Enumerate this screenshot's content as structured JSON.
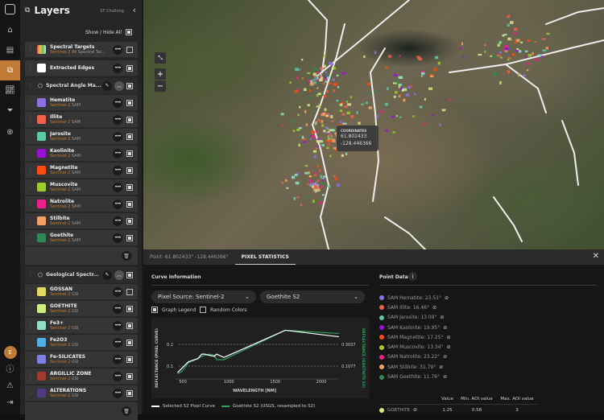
{
  "sidebar": {
    "title": "Layers",
    "user_label": "ST Challeng",
    "show_hide_all": "Show / Hide All",
    "top_layers": [
      {
        "name": "Spectral Targets",
        "source": "Sentinel-2",
        "detail": "All Spectral Tar...",
        "swatch": "linear-gradient(90deg,#e05050,#f0c040,#60c060,#e0e0e0)",
        "visible": false
      },
      {
        "name": "Extracted Edges",
        "swatch": "#ffffff",
        "visible": true
      }
    ],
    "groups": [
      {
        "title": "Spectral Angle Ma...",
        "items": [
          {
            "name": "Hematite",
            "source": "Sentinel-2",
            "detail": "SAM",
            "color": "#8e6fe0"
          },
          {
            "name": "Illite",
            "source": "Sentinel-2",
            "detail": "SAM",
            "color": "#f0604a"
          },
          {
            "name": "Jarosite",
            "source": "Sentinel-2",
            "detail": "SAM",
            "color": "#5cc9a7"
          },
          {
            "name": "Kaolinite",
            "source": "Sentinel-2",
            "detail": "SAM",
            "color": "#9b10d8"
          },
          {
            "name": "Magnetite",
            "source": "Sentinel-2",
            "detail": "SAM",
            "color": "#ff4a12"
          },
          {
            "name": "Muscovite",
            "source": "Sentinel-2",
            "detail": "SAM",
            "color": "#9ccc30"
          },
          {
            "name": "Natrolite",
            "source": "Sentinel-2",
            "detail": "SAM",
            "color": "#f0208a"
          },
          {
            "name": "Stilbite",
            "source": "Sentinel-2",
            "detail": "SAM",
            "color": "#f5a060"
          },
          {
            "name": "Goethite",
            "source": "Sentinel-2",
            "detail": "SAM",
            "color": "#2e8a50"
          }
        ]
      },
      {
        "title": "Geological Spectr...",
        "items": [
          {
            "name": "GOSSAN",
            "source": "Sentinel-2",
            "detail": "GSI",
            "color": "#e0d860",
            "visible": false
          },
          {
            "name": "GOETHITE",
            "source": "Sentinel-2",
            "detail": "GSI",
            "color": "#d0ec80"
          },
          {
            "name": "Fe3+",
            "source": "Sentinel-2",
            "detail": "GSI",
            "color": "#90e0c8"
          },
          {
            "name": "Fe2O3",
            "source": "Sentinel-2",
            "detail": "GSI",
            "color": "#50b0e8"
          },
          {
            "name": "Fe-SILICATES",
            "source": "Sentinel-2",
            "detail": "GSI",
            "color": "#8080e0"
          },
          {
            "name": "ARGILLIC ZONE",
            "source": "Sentinel-2",
            "detail": "GSI",
            "color": "#a03a30"
          },
          {
            "name": "ALTERATIONS",
            "source": "Sentinel-2",
            "detail": "GSI",
            "color": "#503a80"
          }
        ]
      }
    ]
  },
  "rail": {
    "user_initial": "E",
    "accent": "#c07a36"
  },
  "map": {
    "tooltip_label": "COORDINATES",
    "lat": "61.802433",
    "lon": "-128.446366"
  },
  "panel": {
    "point_tab": "Point: 61.802433° -128.446366°",
    "stats_tab": "PIXEL STATISTICS",
    "curve_info": "Curve Information",
    "pixel_source": "Pixel Source: Sentinel-2",
    "target": "Goethite S2",
    "graph_legend": "Graph Legend",
    "random_colors": "Random Colors",
    "legend_pixel": "Selected S2 Pixel Curve",
    "legend_target": "Goethite S2 (USGS, resampled to S2)",
    "point_data": "Point Data",
    "point_items": [
      {
        "label": "SAM Hematite: 23.51°",
        "color": "#8e6fe0"
      },
      {
        "label": "SAM Illite: 16.46°",
        "color": "#f0604a"
      },
      {
        "label": "SAM Jarosite: 13.09°",
        "color": "#5cc9a7"
      },
      {
        "label": "SAM Kaolinite: 19.95°",
        "color": "#9b10d8"
      },
      {
        "label": "SAM Magnetite: 17.25°",
        "color": "#ff4a12"
      },
      {
        "label": "SAM Muscovite: 13.34°",
        "color": "#9ccc30"
      },
      {
        "label": "SAM Natrolite: 23.22°",
        "color": "#f0208a"
      },
      {
        "label": "SAM Stilbite: 31.79°",
        "color": "#f5a060"
      },
      {
        "label": "SAM Goethite: 11.76°",
        "color": "#2e8a50"
      }
    ],
    "table": {
      "headers": [
        "",
        "Value",
        "Min. AOI value",
        "Max. AOI value"
      ],
      "rows": [
        {
          "name": "GOETHITE",
          "color": "#d0ec80",
          "value": "1.25",
          "min": "0.58",
          "max": "3"
        }
      ]
    }
  },
  "chart_data": {
    "type": "line",
    "xlabel": "WAVELENGTH [NM]",
    "ylabel": "REFLECTANCE (PIXEL CURVE)",
    "ylabel_right": "REFLECTANCE (GOETHITE S2)",
    "x_ticks": [
      500,
      1000,
      1500,
      2000
    ],
    "y_ticks": [
      0.1,
      0.2
    ],
    "y_right_ticks": [
      0.1077,
      0.3037
    ],
    "grid": "dashed horizontal",
    "x": [
      443,
      490,
      560,
      665,
      705,
      740,
      783,
      842,
      865,
      945,
      1610,
      2190
    ],
    "series": [
      {
        "name": "Selected S2 Pixel Curve",
        "axis": "left",
        "color": "#ffffff",
        "values": [
          0.07,
          0.09,
          0.12,
          0.135,
          0.155,
          0.155,
          0.15,
          0.145,
          0.155,
          0.14,
          0.265,
          0.235
        ]
      },
      {
        "name": "Goethite S2 (USGS, resampled to S2)",
        "axis": "right",
        "color": "#2ea060",
        "values": [
          0.039,
          0.059,
          0.137,
          0.176,
          0.196,
          0.206,
          0.215,
          0.206,
          0.166,
          0.166,
          0.431,
          0.402
        ]
      }
    ]
  }
}
